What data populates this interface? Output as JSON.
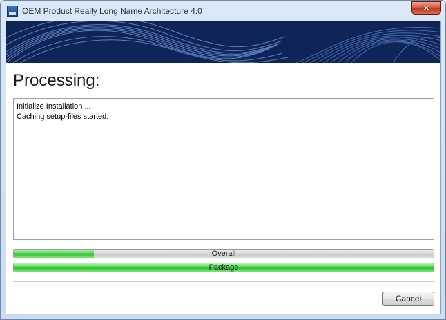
{
  "window": {
    "title": "OEM Product Really Long Name Architecture 4.0",
    "close_glyph": "✕"
  },
  "icons": {
    "app": "app-icon",
    "close": "close-icon"
  },
  "main": {
    "heading": "Processing:",
    "log_lines": [
      "Initialize Installation ...",
      "Caching setup-files started."
    ]
  },
  "progress": {
    "overall": {
      "label": "Overall",
      "value": 0.19
    },
    "package": {
      "label": "Package",
      "value": 1.0
    }
  },
  "buttons": {
    "cancel": "Cancel"
  },
  "colors": {
    "banner": "#0f2557",
    "progress_fill": "#2cc12c"
  }
}
